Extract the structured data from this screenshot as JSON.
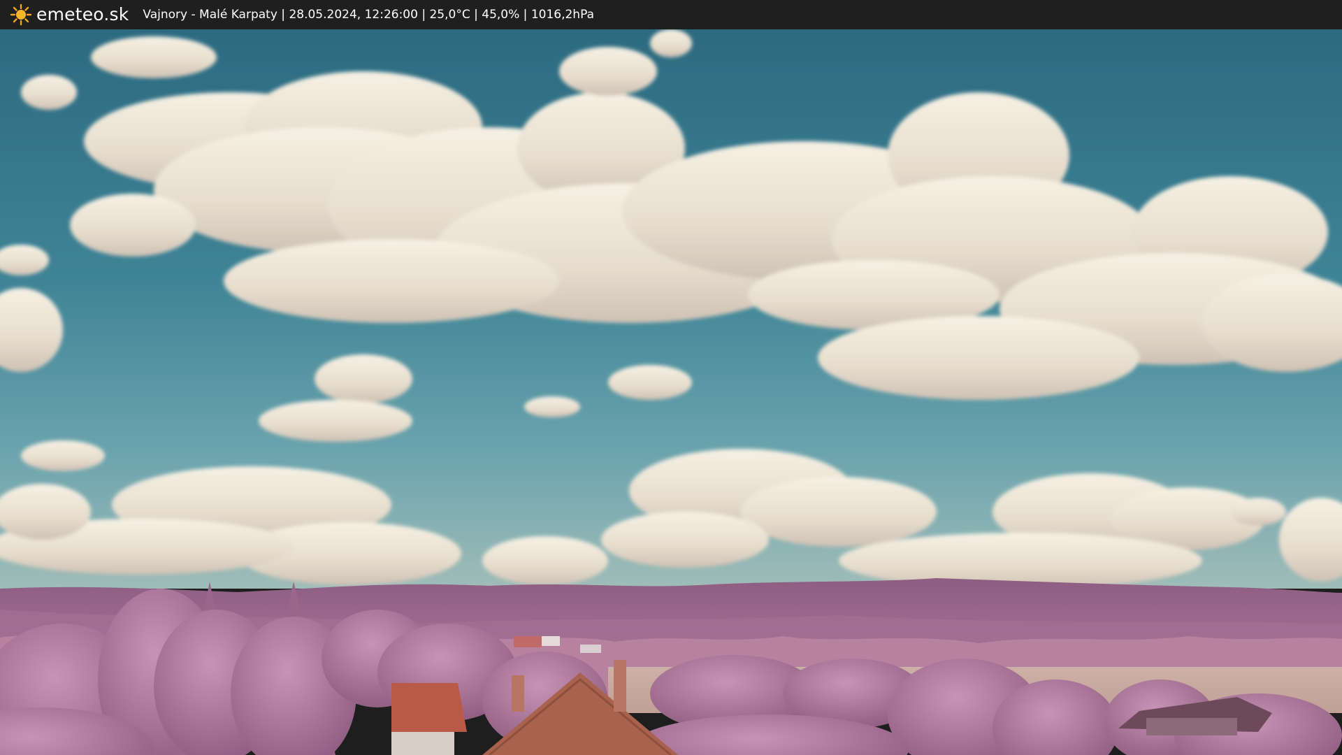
{
  "header": {
    "logo_icon": "sun-icon",
    "brand": "emeteo.sk",
    "location": "Vajnory - Malé Karpaty",
    "timestamp": "28.05.2024, 12:26:00",
    "temperature": "25,0°C",
    "humidity": "45,0%",
    "pressure": "1016,2hPa",
    "separator": " | "
  },
  "colors": {
    "topbar": "#1f1f1f",
    "sun": "#f2a51c",
    "sky_top": "#2f6f84",
    "sky_bottom": "#6aa6b2",
    "cloud": "#ece4d6",
    "foliage": "#b07a9e",
    "roof": "#b85a46"
  }
}
